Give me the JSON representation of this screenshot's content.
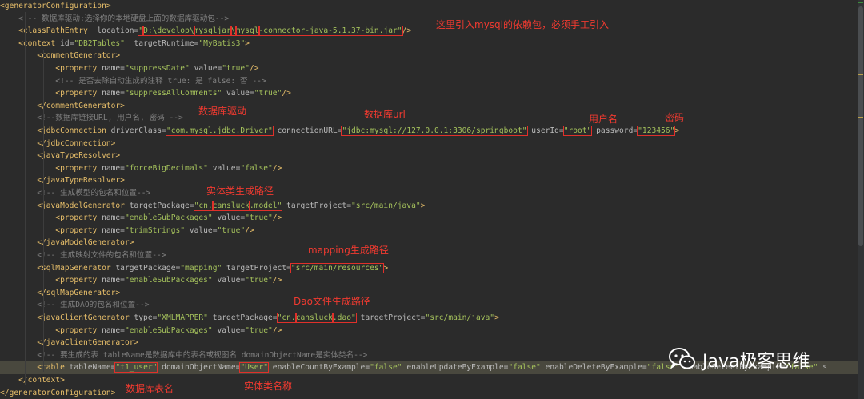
{
  "lines": [
    [
      {
        "t": "<generatorConfiguration>",
        "c": "tag"
      }
    ],
    [
      {
        "t": "    <!-- 数据库驱动:选择你的本地硬盘上面的数据库驱动包-->",
        "c": "cmt"
      }
    ],
    [
      {
        "t": "    <classPathEntry",
        "c": "tag"
      },
      {
        "t": "  location=",
        "c": "attr"
      },
      {
        "t": "\"",
        "c": "val",
        "box": 1
      },
      {
        "t": "D:\\develop\\",
        "c": "val",
        "box": 1
      },
      {
        "t": "mysqljar",
        "c": "val",
        "box": 1,
        "ul": 1
      },
      {
        "t": "\\",
        "c": "val",
        "box": 1
      },
      {
        "t": "mysql",
        "c": "val",
        "box": 1,
        "ul": 1
      },
      {
        "t": "-connector-java-5.1.37-bin.jar\"",
        "c": "val",
        "box": 1
      },
      {
        "t": "/>",
        "c": "tag"
      }
    ],
    [
      {
        "t": "    <context",
        "c": "tag"
      },
      {
        "t": " id=",
        "c": "attr"
      },
      {
        "t": "\"DB2Tables\"",
        "c": "val"
      },
      {
        "t": "  targetRuntime=",
        "c": "attr"
      },
      {
        "t": "\"MyBatis3\"",
        "c": "val"
      },
      {
        "t": ">",
        "c": "tag"
      }
    ],
    [
      {
        "t": "        <commentGenerator>",
        "c": "tag"
      }
    ],
    [
      {
        "t": "            <property",
        "c": "tag"
      },
      {
        "t": " name=",
        "c": "attr"
      },
      {
        "t": "\"suppressDate\"",
        "c": "val"
      },
      {
        "t": " value=",
        "c": "attr"
      },
      {
        "t": "\"true\"",
        "c": "val"
      },
      {
        "t": "/>",
        "c": "tag"
      }
    ],
    [
      {
        "t": "            <!-- 是否去除自动生成的注释 true: 是 false: 否 -->",
        "c": "cmt"
      }
    ],
    [
      {
        "t": "            <property",
        "c": "tag"
      },
      {
        "t": " name=",
        "c": "attr"
      },
      {
        "t": "\"suppressAllComments\"",
        "c": "val"
      },
      {
        "t": " value=",
        "c": "attr"
      },
      {
        "t": "\"true\"",
        "c": "val"
      },
      {
        "t": "/>",
        "c": "tag"
      }
    ],
    [
      {
        "t": "        </commentGenerator>",
        "c": "tag"
      }
    ],
    [
      {
        "t": "        <!--数据库链接URL, 用户名, 密码 -->",
        "c": "cmt"
      }
    ],
    [
      {
        "t": "        <jdbcConnection",
        "c": "tag"
      },
      {
        "t": " driverClass=",
        "c": "attr"
      },
      {
        "t": "\"com.mysql.jdbc.Driver\"",
        "c": "val",
        "box": 1
      },
      {
        "t": " connectionURL=",
        "c": "attr"
      },
      {
        "t": "\"jdbc:mysql://127.0.0.1:3306/springboot\"",
        "c": "val",
        "box": 1
      },
      {
        "t": " userId=",
        "c": "attr"
      },
      {
        "t": "\"root\"",
        "c": "val",
        "box": 1
      },
      {
        "t": " password=",
        "c": "attr"
      },
      {
        "t": "\"123456\"",
        "c": "val",
        "box": 1
      },
      {
        "t": ">",
        "c": "tag"
      }
    ],
    [
      {
        "t": "        </jdbcConnection>",
        "c": "tag"
      }
    ],
    [
      {
        "t": "        <javaTypeResolver>",
        "c": "tag"
      }
    ],
    [
      {
        "t": "            <property",
        "c": "tag"
      },
      {
        "t": " name=",
        "c": "attr"
      },
      {
        "t": "\"forceBigDecimals\"",
        "c": "val"
      },
      {
        "t": " value=",
        "c": "attr"
      },
      {
        "t": "\"false\"",
        "c": "val"
      },
      {
        "t": "/>",
        "c": "tag"
      }
    ],
    [
      {
        "t": "        </javaTypeResolver>",
        "c": "tag"
      }
    ],
    [
      {
        "t": "        <!-- 生成模型的包名和位置-->",
        "c": "cmt"
      }
    ],
    [
      {
        "t": "        <javaModelGenerator",
        "c": "tag"
      },
      {
        "t": " targetPackage=",
        "c": "attr"
      },
      {
        "t": "\"cn.",
        "c": "val",
        "box": 1
      },
      {
        "t": "cansluck",
        "c": "val",
        "box": 1,
        "ul": 1
      },
      {
        "t": ".model\"",
        "c": "val",
        "box": 1
      },
      {
        "t": " targetProject=",
        "c": "attr"
      },
      {
        "t": "\"src/main/java\"",
        "c": "val"
      },
      {
        "t": ">",
        "c": "tag"
      }
    ],
    [
      {
        "t": "            <property",
        "c": "tag"
      },
      {
        "t": " name=",
        "c": "attr"
      },
      {
        "t": "\"enableSubPackages\"",
        "c": "val"
      },
      {
        "t": " value=",
        "c": "attr"
      },
      {
        "t": "\"true\"",
        "c": "val"
      },
      {
        "t": "/>",
        "c": "tag"
      }
    ],
    [
      {
        "t": "            <property",
        "c": "tag"
      },
      {
        "t": " name=",
        "c": "attr"
      },
      {
        "t": "\"trimStrings\"",
        "c": "val"
      },
      {
        "t": " value=",
        "c": "attr"
      },
      {
        "t": "\"true\"",
        "c": "val"
      },
      {
        "t": "/>",
        "c": "tag"
      }
    ],
    [
      {
        "t": "        </javaModelGenerator>",
        "c": "tag"
      }
    ],
    [
      {
        "t": "        <!-- 生成映射文件的包名和位置-->",
        "c": "cmt"
      }
    ],
    [
      {
        "t": "        <sqlMapGenerator",
        "c": "tag"
      },
      {
        "t": " targetPackage=",
        "c": "attr"
      },
      {
        "t": "\"mapping\"",
        "c": "val"
      },
      {
        "t": " targetProject=",
        "c": "attr"
      },
      {
        "t": "\"src/main/resources\"",
        "c": "val",
        "box": 1
      },
      {
        "t": ">",
        "c": "tag"
      }
    ],
    [
      {
        "t": "            <property",
        "c": "tag"
      },
      {
        "t": " name=",
        "c": "attr"
      },
      {
        "t": "\"enableSubPackages\"",
        "c": "val"
      },
      {
        "t": " value=",
        "c": "attr"
      },
      {
        "t": "\"true\"",
        "c": "val"
      },
      {
        "t": "/>",
        "c": "tag"
      }
    ],
    [
      {
        "t": "        </sqlMapGenerator>",
        "c": "tag"
      }
    ],
    [
      {
        "t": "        <!-- 生成DAO的包名和位置-->",
        "c": "cmt"
      }
    ],
    [
      {
        "t": "        <javaClientGenerator",
        "c": "tag"
      },
      {
        "t": " type=",
        "c": "attr"
      },
      {
        "t": "\"",
        "c": "val"
      },
      {
        "t": "XMLMAPPER",
        "c": "val",
        "ul": 1
      },
      {
        "t": "\"",
        "c": "val"
      },
      {
        "t": " targetPackage=",
        "c": "attr"
      },
      {
        "t": "\"cn.",
        "c": "val",
        "box": 1
      },
      {
        "t": "cansluck",
        "c": "val",
        "box": 1,
        "ul": 1
      },
      {
        "t": ".dao\"",
        "c": "val",
        "box": 1
      },
      {
        "t": " targetProject=",
        "c": "attr"
      },
      {
        "t": "\"src/main/java\"",
        "c": "val"
      },
      {
        "t": ">",
        "c": "tag"
      }
    ],
    [
      {
        "t": "            <property",
        "c": "tag"
      },
      {
        "t": " name=",
        "c": "attr"
      },
      {
        "t": "\"enableSubPackages\"",
        "c": "val"
      },
      {
        "t": " value=",
        "c": "attr"
      },
      {
        "t": "\"true\"",
        "c": "val"
      },
      {
        "t": "/>",
        "c": "tag"
      }
    ],
    [
      {
        "t": "        </javaClientGenerator>",
        "c": "tag"
      }
    ],
    [
      {
        "t": "        <!-- 要生成的表 tableName是数据库中的表名或视图名 domainObjectName是实体类名-->",
        "c": "cmt"
      }
    ],
    [
      {
        "t": "        <table",
        "c": "tag"
      },
      {
        "t": " tableName=",
        "c": "attr"
      },
      {
        "t": "\"t1_user\"",
        "c": "val",
        "box": 1
      },
      {
        "t": " domainObjectName=",
        "c": "attr"
      },
      {
        "t": "\"User\"",
        "c": "val",
        "box": 1
      },
      {
        "t": " enableCountByExample=",
        "c": "attr"
      },
      {
        "t": "\"false\"",
        "c": "val"
      },
      {
        "t": " enableUpdateByExample=",
        "c": "attr"
      },
      {
        "t": "\"false\"",
        "c": "val"
      },
      {
        "t": " enableDeleteByExample=",
        "c": "attr"
      },
      {
        "t": "\"false\"",
        "c": "val"
      },
      {
        "t": " enableSelectByExample=",
        "c": "attr"
      },
      {
        "t": "\"false\"",
        "c": "val"
      },
      {
        "t": " s",
        "c": "attr"
      }
    ],
    [
      {
        "t": "    </context>",
        "c": "tag"
      }
    ],
    [
      {
        "t": "</generatorConfiguration>",
        "c": "tag"
      }
    ]
  ],
  "annotations": {
    "dependency_note": "这里引入mysql的依赖包，必须手工引入",
    "driver": "数据库驱动",
    "url": "数据库url",
    "username": "用户名",
    "password": "密码",
    "model_path": "实体类生成路径",
    "mapping_path": "mapping生成路径",
    "dao_path": "Dao文件生成路径",
    "table_name": "数据库表名",
    "entity_name": "实体类名称"
  },
  "watermark": {
    "text": "Java极客思维",
    "icon": "wechat-icon"
  },
  "colors": {
    "background": "#2b2b2b",
    "tag": "#e8bf6a",
    "attribute": "#bababa",
    "value": "#a5c25c",
    "comment": "#808080",
    "annotation": "#f03a30",
    "highlight_line": "#49483e"
  }
}
